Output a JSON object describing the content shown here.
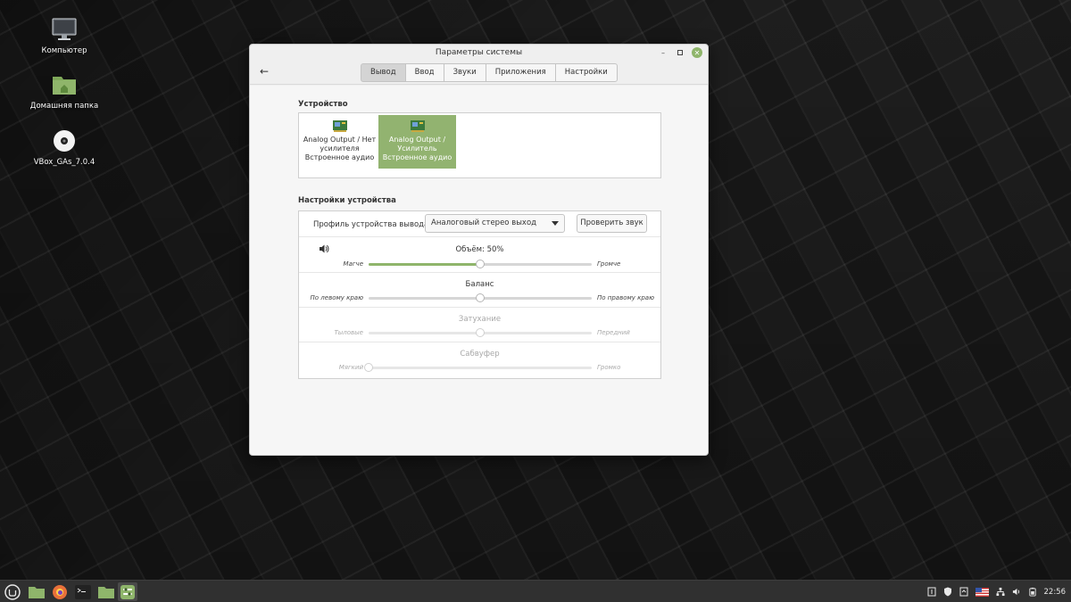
{
  "desktop": {
    "icons": [
      {
        "label": "Компьютер",
        "icon": "computer-icon"
      },
      {
        "label": "Домашняя папка",
        "icon": "home-folder-icon"
      },
      {
        "label": "VBox_GAs_7.0.4",
        "icon": "disc-icon"
      }
    ]
  },
  "window": {
    "title": "Параметры системы",
    "tabs": [
      {
        "label": "Вывод",
        "active": true
      },
      {
        "label": "Ввод",
        "active": false
      },
      {
        "label": "Звуки",
        "active": false
      },
      {
        "label": "Приложения",
        "active": false
      },
      {
        "label": "Настройки",
        "active": false
      }
    ],
    "device_section": {
      "title": "Устройство",
      "devices": [
        {
          "line1": "Analog Output / Нет",
          "line2": "усилителя",
          "line3": "Встроенное аудио",
          "selected": false
        },
        {
          "line1": "Analog Output /",
          "line2": "Усилитель",
          "line3": "Встроенное аудио",
          "selected": true
        }
      ]
    },
    "settings_section": {
      "title": "Настройки устройства",
      "profile_label": "Профиль устройства вывода",
      "profile_value": "Аналоговый стерео выход",
      "test_button": "Проверить звук",
      "sliders": {
        "volume": {
          "title": "Объём: 50%",
          "left": "Магче",
          "right": "Громче",
          "value": 0.5,
          "enabled": true
        },
        "balance": {
          "title": "Баланс",
          "left": "По левому краю",
          "right": "По правому краю",
          "value": 0.5,
          "enabled": true
        },
        "fade": {
          "title": "Затухание",
          "left": "Тыловые",
          "right": "Передний",
          "value": 0.5,
          "enabled": false
        },
        "subwoofer": {
          "title": "Сабвуфер",
          "left": "Мягкий",
          "right": "Громко",
          "value": 0.0,
          "enabled": false
        }
      }
    }
  },
  "taskbar": {
    "clock": "22:56",
    "accent": "#8fb56b"
  }
}
